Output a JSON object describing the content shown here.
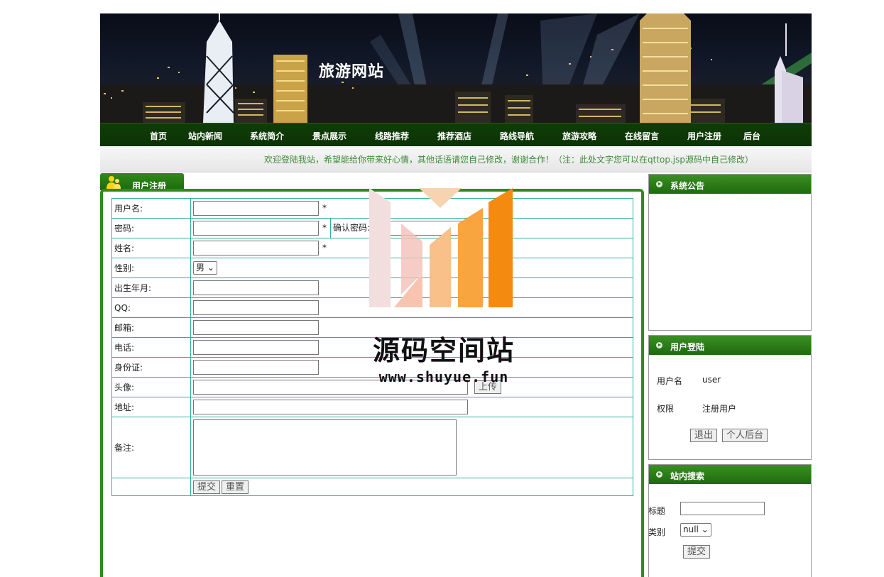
{
  "site": {
    "title": "旅游网站"
  },
  "nav": [
    "首页",
    "站内新闻",
    "系统简介",
    "景点展示",
    "线路推荐",
    "推荐酒店",
    "路线导航",
    "旅游攻略",
    "在线留言",
    "用户注册",
    "后台"
  ],
  "notice_bar": "欢迎登陆我站，希望能给你带来好心情，其他话语请您自己修改，谢谢合作！（注：此处文字您可以在qttop.jsp源码中自己修改）",
  "register": {
    "tab_label": "用户注册",
    "username_label": "用户名:",
    "password_label": "密码:",
    "confirm_password_label": "确认密码:",
    "name_label": "姓名:",
    "gender_label": "性别:",
    "gender_value": "男",
    "birth_label": "出生年月:",
    "qq_label": "QQ:",
    "email_label": "邮箱:",
    "phone_label": "电话:",
    "idcard_label": "身份证:",
    "avatar_label": "头像:",
    "upload_button": "上传",
    "address_label": "地址:",
    "remark_label": "备注:",
    "required_mark": "*",
    "submit_button": "提交",
    "reset_button": "重置"
  },
  "announcement": {
    "title": "系统公告"
  },
  "login": {
    "title": "用户登陆",
    "username_label": "用户名",
    "username_value": "user",
    "role_label": "权限",
    "role_value": "注册用户",
    "logout_button": "退出",
    "profile_button": "个人后台"
  },
  "search": {
    "title": "站内搜索",
    "title_label": "标题",
    "category_label": "类别",
    "category_value": "null",
    "submit_button": "提交"
  },
  "watermark": {
    "text": "源码空间站",
    "url": "www.shuyue.fun"
  },
  "colors": {
    "nav_bg": "#0f3d06",
    "panel_green": "#2f8a1a",
    "table_border": "#2bb0a0",
    "notice_text": "#3f8a3a"
  }
}
